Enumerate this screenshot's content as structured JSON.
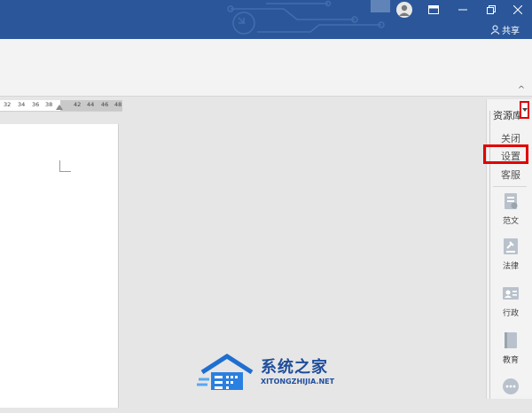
{
  "titlebar": {
    "share_label": "共享",
    "icons": [
      "user-avatar-icon",
      "ribbon-display-icon",
      "minimize-icon",
      "restore-icon",
      "close-icon",
      "share-person-icon"
    ],
    "accent_color": "#2b579a"
  },
  "ruler": {
    "ticks": [
      "32",
      "34",
      "36",
      "38",
      "42",
      "44",
      "46",
      "48"
    ]
  },
  "resource_panel": {
    "title": "资源库",
    "menu": {
      "close": "关闭",
      "settings": "设置",
      "support": "客服"
    },
    "items": [
      {
        "label": "范文",
        "icon": "document-icon"
      },
      {
        "label": "法律",
        "icon": "gavel-icon"
      },
      {
        "label": "行政",
        "icon": "id-card-icon"
      },
      {
        "label": "教育",
        "icon": "book-icon"
      }
    ],
    "more_icon": "more-icon",
    "highlight_color": "#e00000"
  },
  "watermark": {
    "title": "系统之家",
    "url": "XITONGZHIJIA.NET"
  }
}
